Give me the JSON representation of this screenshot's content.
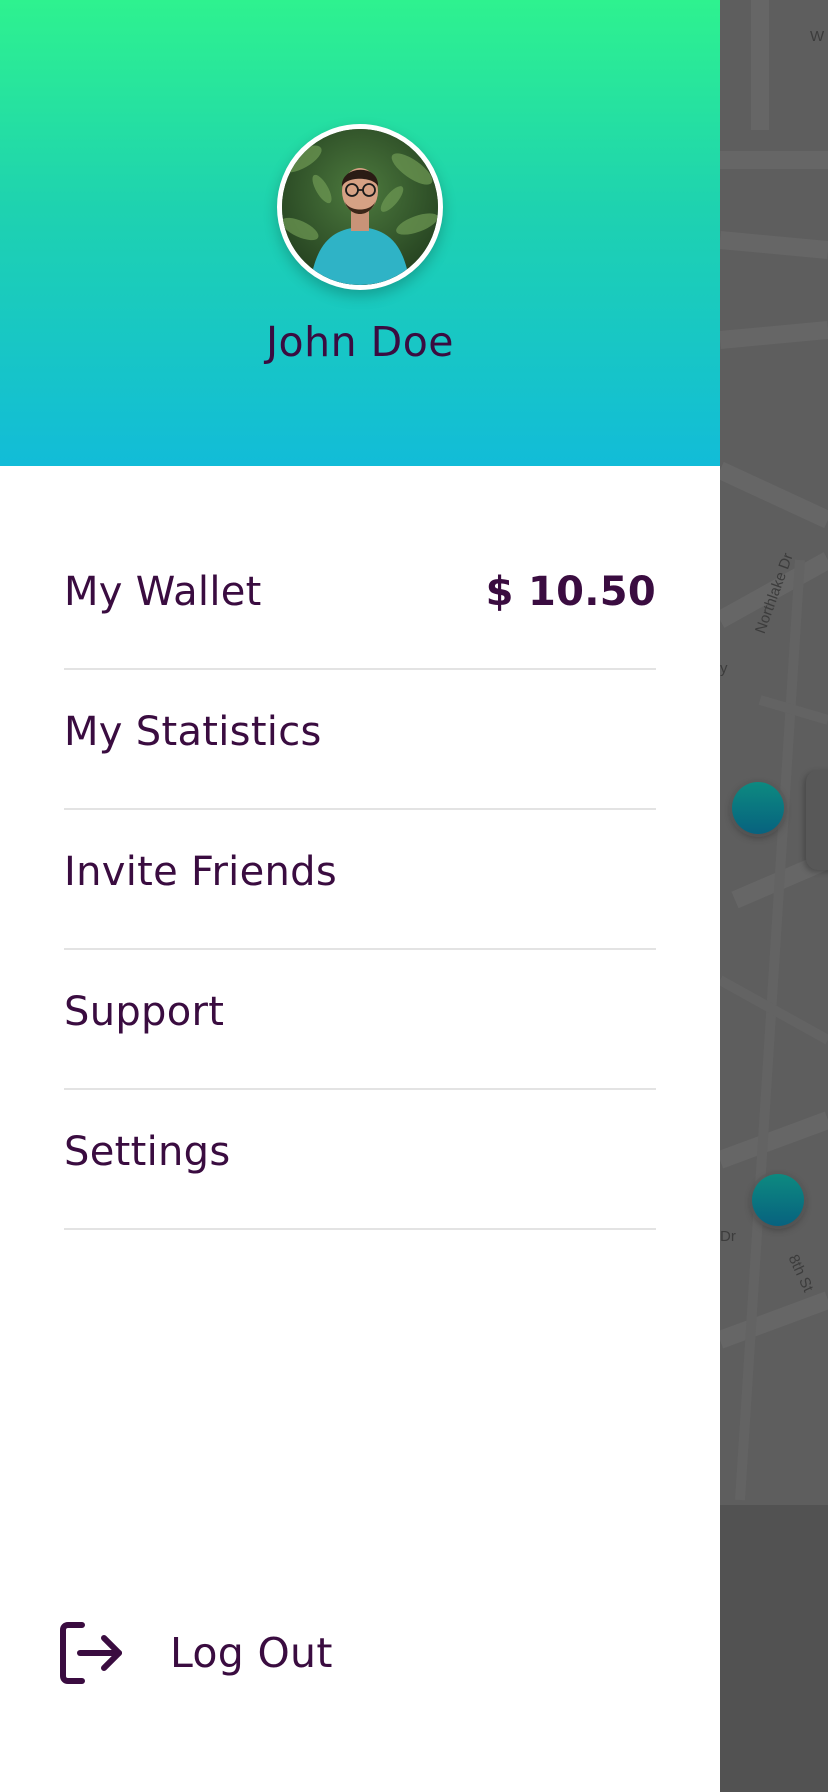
{
  "map": {
    "street_labels": [
      "W",
      "Northlake Dr",
      "y",
      "Dr",
      "8th St"
    ]
  },
  "profile": {
    "name": "John Doe"
  },
  "menu": {
    "items": [
      {
        "label": "My Wallet",
        "value": "$ 10.50"
      },
      {
        "label": "My Statistics"
      },
      {
        "label": "Invite Friends"
      },
      {
        "label": "Support"
      },
      {
        "label": "Settings"
      }
    ]
  },
  "logout": {
    "label": "Log Out",
    "icon": "logout-icon"
  },
  "colors": {
    "header_top": "#2ef28f",
    "header_bottom": "#12bcd8",
    "text": "#3a0c40",
    "divider": "#e3e3e3",
    "marker": "#0d8a80"
  }
}
